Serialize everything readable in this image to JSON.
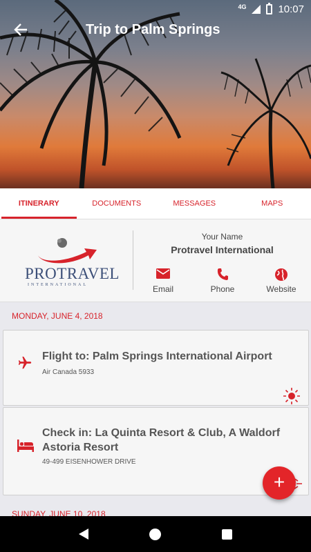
{
  "status_bar": {
    "network": "4G",
    "time": "10:07"
  },
  "toolbar": {
    "title": "Trip to Palm Springs",
    "back_icon": "arrow-back-icon"
  },
  "tabs": [
    {
      "label": "ITINERARY",
      "active": true
    },
    {
      "label": "DOCUMENTS",
      "active": false
    },
    {
      "label": "MESSAGES",
      "active": false
    },
    {
      "label": "MAPS",
      "active": false
    }
  ],
  "agency": {
    "logo_text": "PROTRAVEL",
    "logo_subtext": "INTERNATIONAL",
    "agent_name": "Your Name",
    "company": "Protravel International",
    "contacts": [
      {
        "label": "Email",
        "icon": "email-icon"
      },
      {
        "label": "Phone",
        "icon": "phone-icon"
      },
      {
        "label": "Website",
        "icon": "globe-icon"
      }
    ]
  },
  "itinerary": {
    "days": [
      {
        "date": "MONDAY, JUNE 4, 2018",
        "items": [
          {
            "title": "Flight to: Palm Springs International Airport",
            "subtitle": "Air Canada 5933",
            "icon": "airplane-icon"
          },
          {
            "title": "Check in: La Quinta Resort & Club, A Waldorf Astoria Resort",
            "subtitle": "49-499 EISENHOWER DRIVE",
            "icon": "hotel-bed-icon"
          }
        ]
      },
      {
        "date": "SUNDAY, JUNE 10, 2018",
        "items": []
      }
    ]
  },
  "fab": {
    "label": "+"
  },
  "colors": {
    "accent": "#d7232b",
    "background": "#e9e9ee",
    "card": "#f6f6f6"
  }
}
